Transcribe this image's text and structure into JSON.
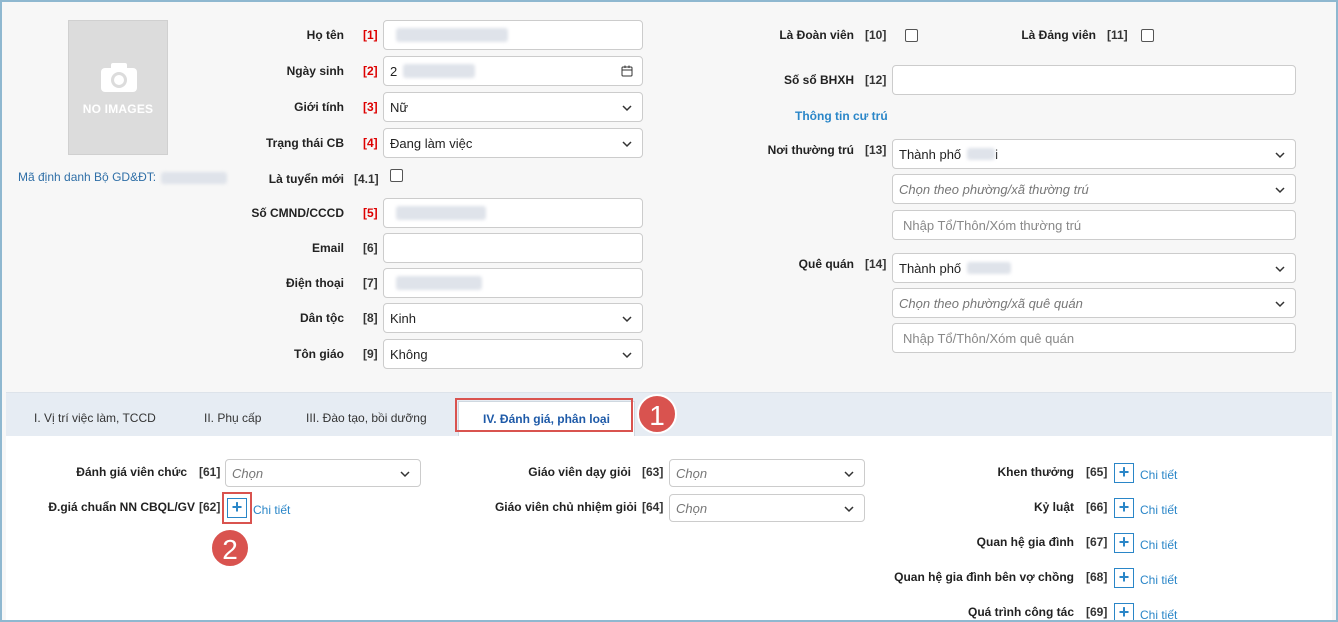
{
  "photo": {
    "no_images": "NO IMAGES"
  },
  "ma_dinh_danh_label": "Mã định danh Bộ GD&ĐT:",
  "left_form": [
    {
      "key": "ho_ten",
      "label": "Họ tên",
      "num": "[1]",
      "required": true,
      "value": "",
      "type": "text"
    },
    {
      "key": "ngay_sinh",
      "label": "Ngày sinh",
      "num": "[2]",
      "required": true,
      "value": "2",
      "type": "date"
    },
    {
      "key": "gioi_tinh",
      "label": "Giới tính",
      "num": "[3]",
      "required": true,
      "value": "Nữ",
      "type": "select"
    },
    {
      "key": "trang_thai",
      "label": "Trạng thái CB",
      "num": "[4]",
      "required": true,
      "value": "Đang làm việc",
      "type": "select"
    },
    {
      "key": "tuyen_moi",
      "label": "Là tuyển mới",
      "num": "[4.1]",
      "required": false,
      "value": "",
      "type": "checkbox"
    },
    {
      "key": "cmnd",
      "label": "Số CMND/CCCD",
      "num": "[5]",
      "required": true,
      "value": "",
      "type": "text"
    },
    {
      "key": "email",
      "label": "Email",
      "num": "[6]",
      "required": false,
      "value": "",
      "type": "text"
    },
    {
      "key": "dien_thoai",
      "label": "Điện thoại",
      "num": "[7]",
      "required": false,
      "value": "",
      "type": "text"
    },
    {
      "key": "dan_toc",
      "label": "Dân tộc",
      "num": "[8]",
      "required": false,
      "value": "Kinh",
      "type": "select"
    },
    {
      "key": "ton_giao",
      "label": "Tôn giáo",
      "num": "[9]",
      "required": false,
      "value": "Không",
      "type": "select"
    }
  ],
  "right_form": {
    "doan_vien": {
      "label": "Là Đoàn viên",
      "num": "[10]"
    },
    "dang_vien": {
      "label": "Là Đảng viên",
      "num": "[11]"
    },
    "bhxh": {
      "label": "Số sổ BHXH",
      "num": "[12]",
      "value": ""
    },
    "section_title": "Thông tin cư trú",
    "noi_thuong_tru": {
      "label": "Nơi thường trú",
      "num": "[13]",
      "city": "Thành phố",
      "ward_placeholder": "Chọn theo phường/xã thường trú",
      "village_placeholder": "Nhập Tổ/Thôn/Xóm thường trú",
      "city_suffix": "i"
    },
    "que_quan": {
      "label": "Quê quán",
      "num": "[14]",
      "city": "Thành phố",
      "ward_placeholder": "Chọn theo phường/xã quê quán",
      "village_placeholder": "Nhập Tổ/Thôn/Xóm quê quán"
    }
  },
  "tabs": [
    {
      "label": "I. Vị trí việc làm, TCCD",
      "active": false
    },
    {
      "label": "II. Phụ cấp",
      "active": false
    },
    {
      "label": "III. Đào tạo, bồi dưỡng",
      "active": false
    },
    {
      "label": "IV. Đánh giá, phân loại",
      "active": true
    }
  ],
  "callouts": {
    "one": "1",
    "two": "2"
  },
  "evaluation": {
    "danh_gia_vien_chuc": {
      "label": "Đánh giá viên chức",
      "num": "[61]",
      "value": "Chọn"
    },
    "dgia_chuan": {
      "label": "Đ.giá chuẩn NN CBQL/GV",
      "num": "[62]",
      "detail": "Chi tiết"
    },
    "gv_day_gioi": {
      "label": "Giáo viên dạy giỏi",
      "num": "[63]",
      "value": "Chọn"
    },
    "gv_chu_nhiem": {
      "label": "Giáo viên chủ nhiệm giỏi",
      "num": "[64]",
      "value": "Chọn"
    },
    "right_items": [
      {
        "label": "Khen thưởng",
        "num": "[65]",
        "detail": "Chi tiết"
      },
      {
        "label": "Kỷ luật",
        "num": "[66]",
        "detail": "Chi tiết"
      },
      {
        "label": "Quan hệ gia đình",
        "num": "[67]",
        "detail": "Chi tiết"
      },
      {
        "label": "Quan hệ gia đình bên vợ chồng",
        "num": "[68]",
        "detail": "Chi tiết"
      },
      {
        "label": "Quá trình công tác",
        "num": "[69]",
        "detail": "Chi tiết"
      }
    ]
  },
  "colors": {
    "accent": "#2a86c8",
    "required": "#dd0000",
    "highlight": "#d9534f",
    "tab_active": "#1e5aa8"
  }
}
